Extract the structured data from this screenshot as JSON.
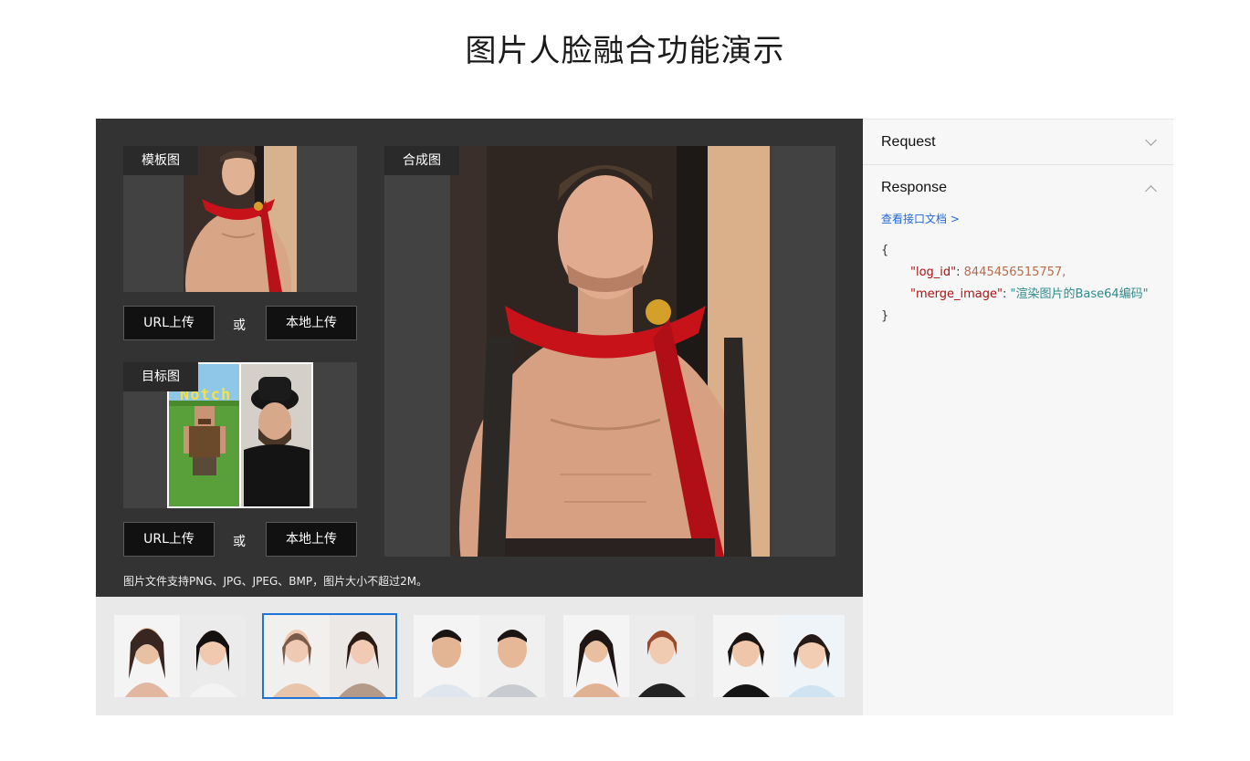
{
  "page": {
    "title": "图片人脸融合功能演示"
  },
  "template_box": {
    "label": "模板图"
  },
  "result_box": {
    "label": "合成图"
  },
  "target_box": {
    "label": "目标图",
    "notch_text": "Notch"
  },
  "upload_row_1": {
    "url_label": "URL上传",
    "or": "或",
    "local_label": "本地上传"
  },
  "upload_row_2": {
    "url_label": "URL上传",
    "or": "或",
    "local_label": "本地上传"
  },
  "hint": "图片文件支持PNG、JPG、JPEG、BMP，图片大小不超过2M。",
  "side": {
    "request_label": "Request",
    "response_label": "Response",
    "doc_link": "查看接口文档 >",
    "json_open": "{",
    "json_close": "}",
    "log_id_key": "\"log_id\"",
    "log_id_value": "8445456515757,",
    "merge_key": "\"merge_image\"",
    "merge_value": "\"渲染图片的Base64编码\"",
    "colon": ": "
  },
  "samples": [
    {
      "id": "sample-1",
      "selected": false
    },
    {
      "id": "sample-2",
      "selected": true
    },
    {
      "id": "sample-3",
      "selected": false
    },
    {
      "id": "sample-4",
      "selected": false
    },
    {
      "id": "sample-5",
      "selected": false
    }
  ],
  "colors": {
    "panel_bg": "#333333",
    "accent": "#1e73d6",
    "link": "#2468d6"
  }
}
